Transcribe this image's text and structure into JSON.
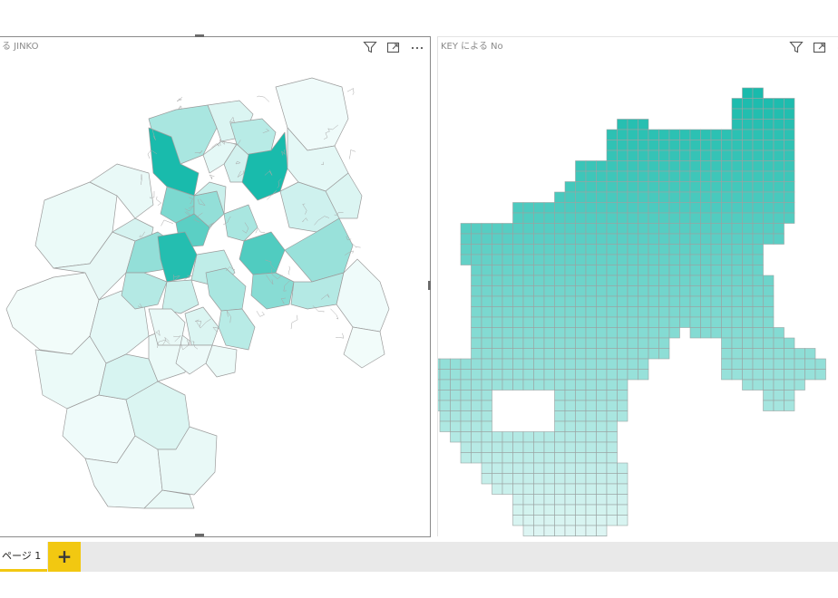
{
  "report": {
    "visuals": [
      {
        "title": "KEY による JINKO",
        "visible_title": "る JINKO",
        "kind": "filled-map (municipal boundaries)",
        "header_icons": [
          "filter-icon",
          "focus-mode-icon",
          "more-options-icon"
        ]
      },
      {
        "title": "KEY による No",
        "kind": "filled-map (mesh grid)",
        "header_icons": [
          "filter-icon",
          "focus-mode-icon",
          "more-options-icon"
        ]
      }
    ],
    "pages": {
      "tabs": [
        {
          "label": "ページ 1",
          "active": true
        }
      ],
      "add_label": "+"
    }
  },
  "theme": {
    "accent": "#f2c811",
    "map_high": "#19bbac",
    "map_low": "#f6fdfc",
    "map_stroke": "#b0b0b0"
  }
}
